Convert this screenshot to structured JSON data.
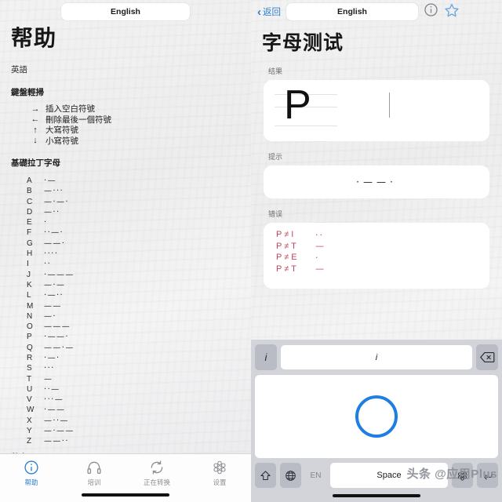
{
  "left": {
    "language_button": "English",
    "title": "帮助",
    "subtitle": "英語",
    "swipe_section": "鍵盤輕掃",
    "swipe_items": [
      {
        "arrow": "→",
        "label": "插入空白符號"
      },
      {
        "arrow": "←",
        "label": "刪除最後一個符號"
      },
      {
        "arrow": "↑",
        "label": "大寫符號"
      },
      {
        "arrow": "↓",
        "label": "小寫符號"
      }
    ],
    "alphabet_section": "基礎拉丁字母",
    "alphabet": [
      {
        "letter": "A",
        "code": "·—"
      },
      {
        "letter": "B",
        "code": "—···"
      },
      {
        "letter": "C",
        "code": "—·—·"
      },
      {
        "letter": "D",
        "code": "—··"
      },
      {
        "letter": "E",
        "code": "·"
      },
      {
        "letter": "F",
        "code": "··—·"
      },
      {
        "letter": "G",
        "code": "——·"
      },
      {
        "letter": "H",
        "code": "····"
      },
      {
        "letter": "I",
        "code": "··"
      },
      {
        "letter": "J",
        "code": "·———"
      },
      {
        "letter": "K",
        "code": "—·—"
      },
      {
        "letter": "L",
        "code": "·—··"
      },
      {
        "letter": "M",
        "code": "——"
      },
      {
        "letter": "N",
        "code": "—·"
      },
      {
        "letter": "O",
        "code": "———"
      },
      {
        "letter": "P",
        "code": "·——·"
      },
      {
        "letter": "Q",
        "code": "——·—"
      },
      {
        "letter": "R",
        "code": "·—·"
      },
      {
        "letter": "S",
        "code": "···"
      },
      {
        "letter": "T",
        "code": "—"
      },
      {
        "letter": "U",
        "code": "··—"
      },
      {
        "letter": "V",
        "code": "···—"
      },
      {
        "letter": "W",
        "code": "·——"
      },
      {
        "letter": "X",
        "code": "—··—"
      },
      {
        "letter": "Y",
        "code": "—·——"
      },
      {
        "letter": "Z",
        "code": "——··"
      }
    ],
    "cut_section": "數字",
    "tabs": [
      {
        "label": "帮助",
        "icon": "info-icon",
        "active": true
      },
      {
        "label": "培训",
        "icon": "headphones-icon",
        "active": false
      },
      {
        "label": "正在转换",
        "icon": "refresh-icon",
        "active": false
      },
      {
        "label": "设置",
        "icon": "settings-icon",
        "active": false
      }
    ]
  },
  "right": {
    "back_label": "返回",
    "language_button": "English",
    "info_icon": "info-icon",
    "star_icon": "star-icon",
    "title": "字母测试",
    "result_label": "结果",
    "result_letter": "P",
    "hint_label": "提示",
    "hint_code": "·——·",
    "error_label": "错误",
    "errors": [
      {
        "pair": "P ≠ I",
        "code": "··"
      },
      {
        "pair": "P ≠ T",
        "code": "—"
      },
      {
        "pair": "P ≠ E",
        "code": "·"
      },
      {
        "pair": "P ≠ T",
        "code": "—"
      }
    ],
    "keyboard": {
      "info_key": "i",
      "input_value": "i",
      "delete_key": "delete-icon",
      "shift_key": "shift-icon",
      "globe_key": "globe-icon",
      "lang_key": "EN",
      "space_key": "Space",
      "flower_key": "flower-icon",
      "return_key": "return-icon"
    },
    "watermark": "头条 @应用Plus"
  },
  "colors": {
    "accent_blue": "#2f7fd0",
    "circle_blue": "#1f7fe0",
    "error_red": "#c0485f",
    "underline_pink": "#b5566e",
    "muted": "#8e8e93"
  }
}
